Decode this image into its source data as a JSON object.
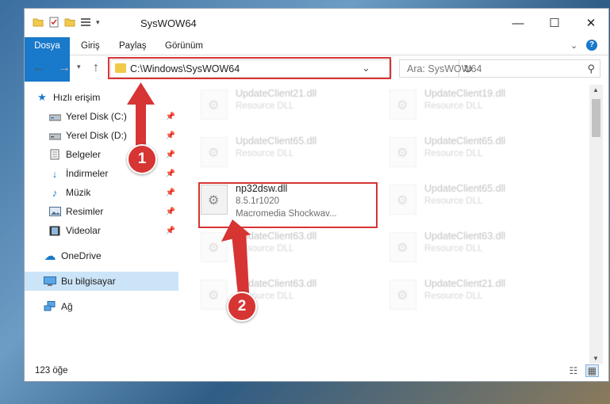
{
  "window": {
    "title": "SysWOW64",
    "controls": [
      "—",
      "☐",
      "✕"
    ]
  },
  "ribbon": {
    "tabs": [
      "Dosya",
      "Giriş",
      "Paylaş",
      "Görünüm"
    ]
  },
  "nav": {
    "address": "C:\\Windows\\SysWOW64",
    "search_placeholder": "Ara: SysWOW64"
  },
  "sidebar": {
    "items": [
      {
        "label": "Hızlı erişim",
        "icon": "star-icon",
        "pinned": false
      },
      {
        "label": "Yerel Disk (C:)",
        "icon": "drive-icon",
        "pinned": true
      },
      {
        "label": "Yerel Disk (D:)",
        "icon": "drive-icon",
        "pinned": true
      },
      {
        "label": "Belgeler",
        "icon": "documents-icon",
        "pinned": true
      },
      {
        "label": "İndirmeler",
        "icon": "download-icon",
        "pinned": true
      },
      {
        "label": "Müzik",
        "icon": "music-icon",
        "pinned": true
      },
      {
        "label": "Resimler",
        "icon": "pictures-icon",
        "pinned": true
      },
      {
        "label": "Videolar",
        "icon": "video-icon",
        "pinned": true
      },
      {
        "label": "OneDrive",
        "icon": "cloud-icon",
        "pinned": false
      },
      {
        "label": "Bu bilgisayar",
        "icon": "computer-icon",
        "pinned": false
      },
      {
        "label": "Ağ",
        "icon": "network-icon",
        "pinned": false
      }
    ]
  },
  "files": {
    "highlighted": {
      "name": "np32dsw.dll",
      "version": "8.5.1r1020",
      "description": "Macromedia Shockwav..."
    },
    "background": [
      {
        "name": "UpdateClient21.dll",
        "type": "Resource DLL"
      },
      {
        "name": "UpdateClient19.dll",
        "type": "Resource DLL"
      },
      {
        "name": "UpdateClient65.dll",
        "type": "Resource DLL"
      },
      {
        "name": "UpdateClient65.dll",
        "type": "Resource DLL"
      },
      {
        "name": "UpdateClient65.dll",
        "type": "Resource DLL"
      },
      {
        "name": "UpdateClient63.dll",
        "type": "Resource DLL"
      },
      {
        "name": "UpdateClient63.dll",
        "type": "Resource DLL"
      },
      {
        "name": "UpdateClient63.dll",
        "type": "Resource DLL"
      },
      {
        "name": "UpdateClient21.dll",
        "type": "Resource DLL"
      }
    ]
  },
  "status": {
    "count": "123 öğe"
  },
  "annotations": {
    "step1": "1",
    "step2": "2"
  },
  "colors": {
    "accent": "#1979ca",
    "highlight": "#d73434",
    "selection": "#cce4f7"
  }
}
